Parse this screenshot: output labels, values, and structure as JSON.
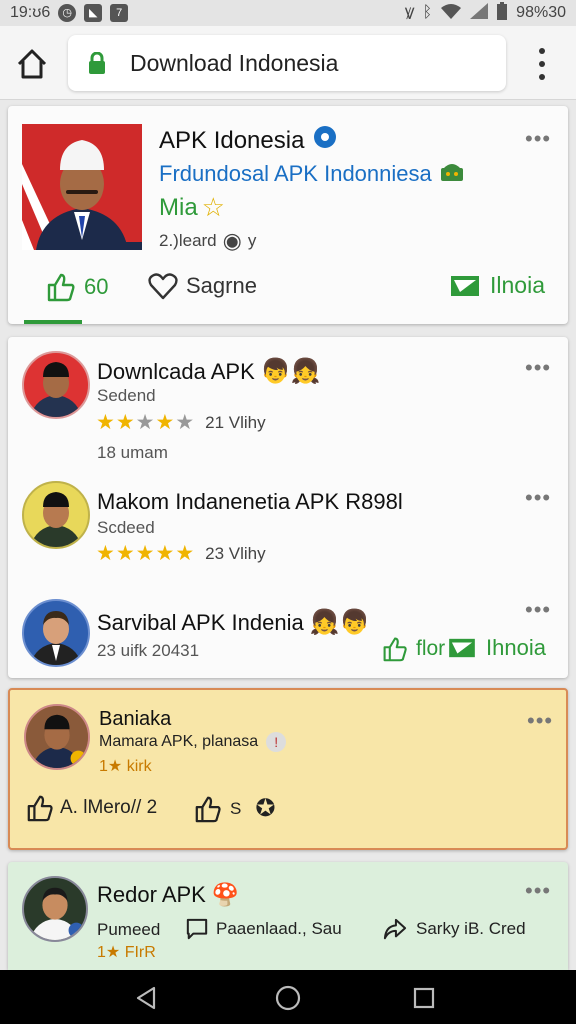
{
  "status_bar": {
    "time": "19:ʊ6",
    "battery": "98%30"
  },
  "browser": {
    "url_text": "Download Indonesia"
  },
  "featured": {
    "title": "APK Idonesia",
    "subtitle": "Frdundosal APK Indonniesa",
    "author": "Mia",
    "meta": "2.)leard",
    "meta_tail": "y",
    "likes": "60",
    "share_label": "Sagrne",
    "action_label": "Ilnoia"
  },
  "list_card": {
    "items": [
      {
        "title": "Downlcada APK",
        "sub": "Sedend",
        "rating": 3.5,
        "rating_text": "21 Vlihy",
        "extra": "18 umam"
      },
      {
        "title": "Makom Indanenetia  APK R898l",
        "sub": "Scdeed",
        "rating": 5,
        "rating_text": "23 Vlihy"
      },
      {
        "title": "Sarvibal APK Indenia",
        "sub": "23 uifk 20431",
        "like_label": "flor",
        "action_label": "Ihnoia"
      }
    ]
  },
  "highlight_card": {
    "title": "Baniaka",
    "sub": "Mamara APK, planasa",
    "rating_text": "1★ kirk",
    "like_label": "A. lMero// 2",
    "share_label": "S"
  },
  "bottom_card": {
    "title": "Redor APK",
    "sub": "Pumeed",
    "rating_text": "1★ FIrR",
    "comment_label": "Paaenlaad.,  Sau",
    "share_label": "Sarky  iB. Cred"
  },
  "colors": {
    "accent_green": "#2f9a3a",
    "link_blue": "#1a6fc4",
    "highlight_bg": "#f8e6a8",
    "bottom_bg": "#dcefdc"
  }
}
